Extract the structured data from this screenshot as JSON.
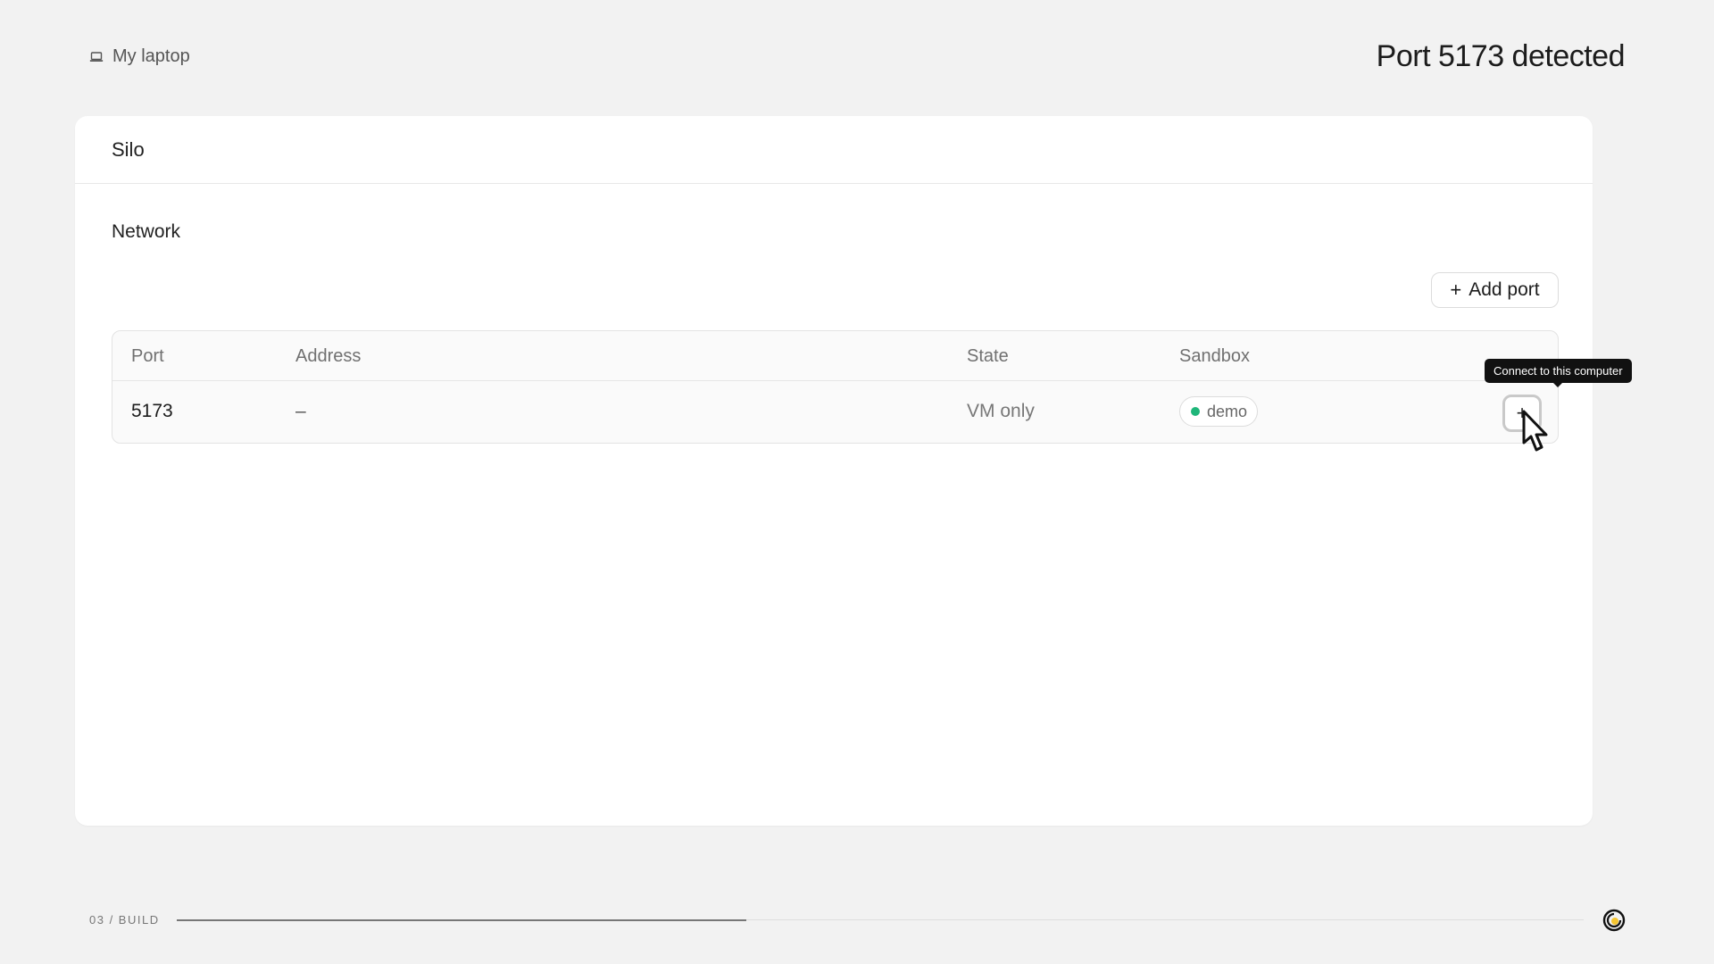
{
  "header": {
    "device_label": "My laptop",
    "headline": "Port 5173 detected"
  },
  "card": {
    "title": "Silo",
    "section_title": "Network",
    "add_port_label": "Add port",
    "table": {
      "columns": [
        "Port",
        "Address",
        "State",
        "Sandbox"
      ],
      "rows": [
        {
          "port": "5173",
          "address": "–",
          "state": "VM only",
          "sandbox": "demo",
          "sandbox_status_color": "#1fb67a"
        }
      ]
    },
    "tooltip": "Connect to this computer"
  },
  "footer": {
    "section_label": "03 / BUILD",
    "progress_fraction": 0.405
  },
  "icons": {
    "device": "laptop-icon",
    "add": "plus-icon",
    "connect": "plus-icon",
    "cursor": "mouse-pointer-icon",
    "logo": "brand-logo-icon"
  },
  "colors": {
    "background": "#f2f2f2",
    "card": "#ffffff",
    "status_green": "#1fb67a",
    "tooltip_bg": "#111111"
  }
}
